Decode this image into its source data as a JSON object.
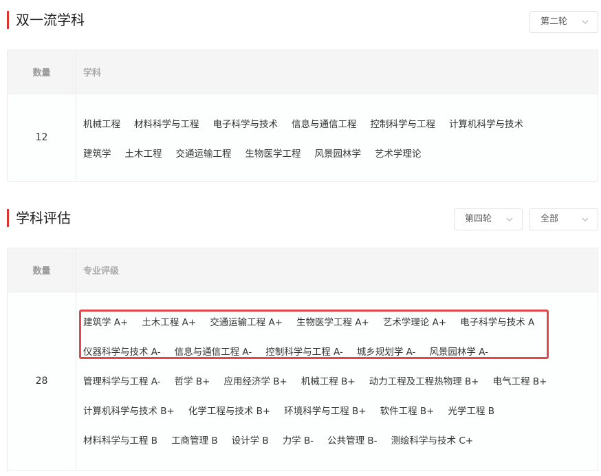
{
  "section1": {
    "title": "双一流学科",
    "round_select": "第二轮",
    "table": {
      "headers": [
        "数量",
        "学科"
      ],
      "count": "12",
      "rows": [
        [
          "机械工程",
          "材料科学与工程",
          "电子科学与技术",
          "信息与通信工程",
          "控制科学与工程",
          "计算机科学与技术"
        ],
        [
          "建筑学",
          "土木工程",
          "交通运输工程",
          "生物医学工程",
          "风景园林学",
          "艺术学理论"
        ]
      ]
    }
  },
  "section2": {
    "title": "学科评估",
    "round_select": "第四轮",
    "scope_select": "全部",
    "table": {
      "headers": [
        "数量",
        "专业评级"
      ],
      "count": "28",
      "rows": [
        [
          "建筑学 A+",
          "土木工程 A+",
          "交通运输工程 A+",
          "生物医学工程 A+",
          "艺术学理论 A+",
          "电子科学与技术 A"
        ],
        [
          "仪器科学与技术 A-",
          "信息与通信工程 A-",
          "控制科学与工程 A-",
          "城乡规划学 A-",
          "风景园林学 A-"
        ],
        [
          "管理科学与工程 A-",
          "哲学 B+",
          "应用经济学 B+",
          "机械工程 B+",
          "动力工程及工程热物理 B+",
          "电气工程 B+"
        ],
        [
          "计算机科学与技术 B+",
          "化学工程与技术 B+",
          "环境科学与工程 B+",
          "软件工程 B+",
          "光学工程 B"
        ],
        [
          "材料科学与工程 B",
          "工商管理 B",
          "设计学 B",
          "力学 B-",
          "公共管理 B-",
          "测绘科学与技术 C+"
        ]
      ]
    }
  },
  "colors": {
    "accent": "#d9332f",
    "highlight": "#e0484c",
    "header_bg": "#f5f5f5"
  },
  "icons": {
    "select_arrow": "chevron-down-icon"
  }
}
